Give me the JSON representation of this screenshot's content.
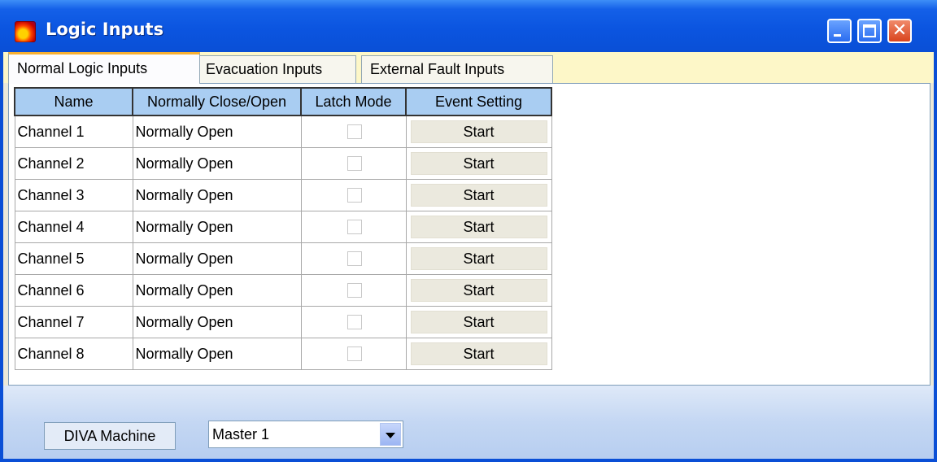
{
  "window": {
    "title": "Logic Inputs",
    "icon": "app-icon",
    "controls": [
      "minimize",
      "maximize",
      "close"
    ]
  },
  "tabs": [
    {
      "label": "Normal Logic Inputs",
      "active": true
    },
    {
      "label": "Evacuation Inputs",
      "active": false
    },
    {
      "label": "External Fault Inputs",
      "active": false
    }
  ],
  "table": {
    "headers": [
      "Name",
      "Normally Close/Open",
      "Latch Mode",
      "Event Setting"
    ],
    "rows": [
      {
        "name": "Channel 1",
        "mode": "Normally Open",
        "latch": false,
        "event": "Start"
      },
      {
        "name": "Channel 2",
        "mode": "Normally Open",
        "latch": false,
        "event": "Start"
      },
      {
        "name": "Channel 3",
        "mode": "Normally Open",
        "latch": false,
        "event": "Start"
      },
      {
        "name": "Channel 4",
        "mode": "Normally Open",
        "latch": false,
        "event": "Start"
      },
      {
        "name": "Channel 5",
        "mode": "Normally Open",
        "latch": false,
        "event": "Start"
      },
      {
        "name": "Channel 6",
        "mode": "Normally Open",
        "latch": false,
        "event": "Start"
      },
      {
        "name": "Channel 7",
        "mode": "Normally Open",
        "latch": false,
        "event": "Start"
      },
      {
        "name": "Channel 8",
        "mode": "Normally Open",
        "latch": false,
        "event": "Start"
      }
    ]
  },
  "footer": {
    "machine_label": "DIVA Machine",
    "machine_select": "Master 1"
  },
  "colors": {
    "title_bar": "#0a4fd6",
    "header_fill": "#a9cdf2",
    "active_tab_accent": "#f7b032",
    "tab_strip": "#fdf7c8"
  }
}
